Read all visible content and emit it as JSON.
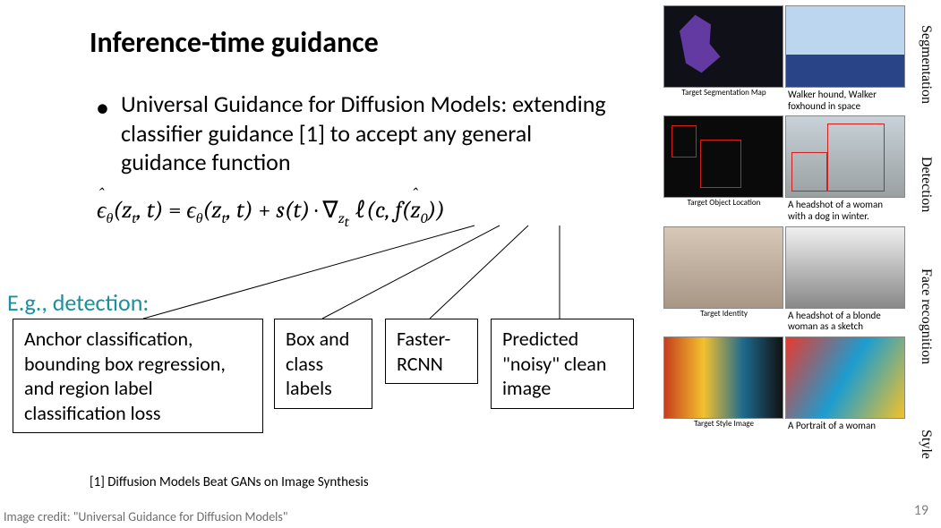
{
  "title": "Inference-time guidance",
  "bullet": "Universal Guidance for Diffusion Models: extending classifier guidance [1] to accept any general guidance function",
  "equation": {
    "lhs_eps": "ϵ",
    "theta": "θ",
    "z": "z",
    "t": "t",
    "s": "s",
    "nabla": "∇",
    "ell": "ℓ",
    "c": "c",
    "f": "f",
    "full_plain": "ϵ̂_θ(z_t, t) = ϵ_θ(z_t, t) + s(t) · ∇_{z_t} ℓ(c, f(ẑ_0))"
  },
  "eg_label": "E.g., detection:",
  "boxes": {
    "b1": "Anchor classification, bounding box regression, and region label classification loss",
    "b2": "Box and class labels",
    "b3": "Faster-RCNN",
    "b4": "Predicted \"noisy\" clean image"
  },
  "citation": "[1] Diffusion Models Beat GANs on Image Synthesis",
  "image_credit": "Image credit: \"Universal Guidance for Diffusion Models\"",
  "page_number": "19",
  "right_panel": {
    "rows": [
      {
        "label": "Segmentation",
        "thumb_caption": "Target Segmentation Map",
        "caption": "Walker hound, Walker foxhound in space"
      },
      {
        "label": "Detection",
        "thumb_caption": "Target Object Location",
        "caption": "A headshot of a woman with a dog in winter."
      },
      {
        "label": "Face recognition",
        "thumb_caption": "Target Identity",
        "caption": "A headshot of a blonde woman as a sketch"
      },
      {
        "label": "Style",
        "thumb_caption": "Target Style Image",
        "caption": "A Portrait of a woman"
      }
    ]
  }
}
